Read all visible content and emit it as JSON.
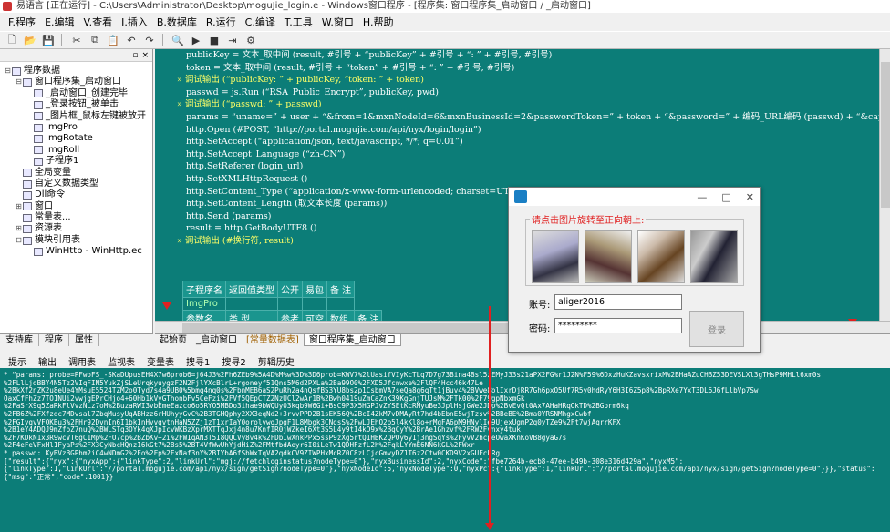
{
  "window": {
    "title": "易语言 [正在运行] - C:\\Users\\Administrator\\Desktop\\moguJie_login.e - Windows窗口程序 - [程序集: 窗口程序集_启动窗口 / _启动窗口]"
  },
  "menu": [
    "F.程序",
    "E.编辑",
    "V.查看",
    "I.插入",
    "B.数据库",
    "R.运行",
    "C.编译",
    "T.工具",
    "W.窗口",
    "H.帮助"
  ],
  "toolbar_icons": [
    "new-icon",
    "open-icon",
    "save-icon",
    "cut-icon",
    "copy-icon",
    "paste-icon",
    "undo-icon",
    "redo-icon",
    "find-icon",
    "run-icon",
    "stop-icon",
    "step-icon",
    "debug-icon"
  ],
  "tree": {
    "header_close": "×",
    "nodes": [
      {
        "label": "程序数据",
        "indent": 0,
        "toggle": "-"
      },
      {
        "label": "窗口程序集_启动窗口",
        "indent": 1,
        "toggle": "-"
      },
      {
        "label": "_启动窗口_创建完毕",
        "indent": 2,
        "toggle": ""
      },
      {
        "label": "_登录按钮_被单击",
        "indent": 2,
        "toggle": ""
      },
      {
        "label": "_图片框_鼠标左键被放开",
        "indent": 2,
        "toggle": ""
      },
      {
        "label": "ImgPro",
        "indent": 2,
        "toggle": ""
      },
      {
        "label": "ImgRotate",
        "indent": 2,
        "toggle": ""
      },
      {
        "label": "ImgRoll",
        "indent": 2,
        "toggle": ""
      },
      {
        "label": "子程序1",
        "indent": 2,
        "toggle": ""
      },
      {
        "label": "全局变量",
        "indent": 1,
        "toggle": ""
      },
      {
        "label": "自定义数据类型",
        "indent": 1,
        "toggle": ""
      },
      {
        "label": "Dll命令",
        "indent": 1,
        "toggle": ""
      },
      {
        "label": "窗口",
        "indent": 1,
        "toggle": "+"
      },
      {
        "label": "常量表...",
        "indent": 1,
        "toggle": ""
      },
      {
        "label": "资源表",
        "indent": 1,
        "toggle": "+"
      },
      {
        "label": "模块引用表",
        "indent": 1,
        "toggle": "-"
      },
      {
        "label": "WinHttp - WinHttp.ec",
        "indent": 2,
        "toggle": ""
      }
    ]
  },
  "left_tabs": [
    "支持库",
    "程序",
    "属性"
  ],
  "code_lines": [
    {
      "text": "publicKey = 文本_取中间 (result, #引号 + “publicKey” + #引号 + “: ” + #引号, #引号)",
      "bullet": false
    },
    {
      "text": "token = 文本_取中间 (result, #引号 + “token” + #引号 + “: ” + #引号, #引号)",
      "bullet": false
    },
    {
      "text": "调试输出 (“publicKey: ” + publicKey, “token: ” + token)",
      "bullet": true
    },
    {
      "text": "",
      "bullet": false
    },
    {
      "text": "passwd = js.Run (“RSA_Public_Encrypt”, publicKey, pwd)",
      "bullet": false
    },
    {
      "text": "调试输出 (“passwd: ” + passwd)",
      "bullet": true
    },
    {
      "text": "",
      "bullet": false
    },
    {
      "text": "params = “uname=” + user + “&from=1&mxnNodeId=6&mxnBusinessId=2&passwordToken=” + token + “&password=” + 编码_URL编码 (passwd) + “&captkey=” + capkey",
      "bullet": false
    },
    {
      "text": "http.Open (#POST, “http://portal.mogujie.com/api/nyx/login/login”)",
      "bullet": false
    },
    {
      "text": "http.SetAccept (“application/json, text/javascript, */*; q=0.01”)",
      "bullet": false
    },
    {
      "text": "http.SetAccept_Language (“zh-CN”)",
      "bullet": false
    },
    {
      "text": "http.SetReferer (login_url)",
      "bullet": false
    },
    {
      "text": "http.SetXMLHttpRequest ()",
      "bullet": false
    },
    {
      "text": "http.SetContent_Type (“application/x-www-form-urlencoded; charset=UTF-8”)",
      "bullet": false
    },
    {
      "text": "http.SetContent_Length (取文本长度 (params))",
      "bullet": false
    },
    {
      "text": "http.Send (params)",
      "bullet": false
    },
    {
      "text": "result = http.GetBodyUTF8 ()",
      "bullet": false
    },
    {
      "text": "调试输出 (#换行符, result)",
      "bullet": true
    }
  ],
  "sub_table": {
    "headers": [
      "子程序名",
      "返回值类型",
      "公开",
      "易包",
      "备 注"
    ],
    "row1": [
      "ImgPro",
      "",
      "",
      "",
      ""
    ],
    "headers2": [
      "参数名",
      "类 型",
      "参考",
      "可空",
      "数组",
      "备 注"
    ]
  },
  "editor_tabs": [
    "起始页",
    "_启动窗口",
    "[常量数据表]",
    "窗口程序集_启动窗口"
  ],
  "bottom_tabs": [
    "提示",
    "输出",
    "调用表",
    "监视表",
    "变量表",
    "搜寻1",
    "搜寻2",
    "剪辑历史"
  ],
  "output_lines": [
    "* “params: probe=PFwoFS_-SKaDUpusEH4X7w6prob6=j64J3%2Fh6ZEb9%5A4D%M%w%3D%3D6prob=KWV7%2lUasifVIyKcTLq7D7g73Bina4Bsl5zEMyJ33s21aPX2FG%r1J2N%F59%6DxzHuKZavsxrixM%2BHaAZuCHBZ53DEVSLXl3gTHsP9MHLl6xm0s",
    "%2FLlLjdBBY4N5Tz2VIqFIN5YukZjSLeUrqkyuygzF2N2FjlYXcBlrL+rgoneyf51Qns5M6d2PXLa%2Ba99O0%2FXD5Jfcnwxe%2FlQF4Hcc46k47Le",
    "%2BkXf2nZK2u8eUe4YMsuE5524TZM2o0Tyd7s4a9UB0%5bmq4nq0s%2FbnMEB6aS2PuRh2a4nQsfBS3YU8bs2p1CsbmVA7seQa8g6qTt1jBuv4%2BVwe8olIxrDjRR7Gh6pxO5Uf7R5y0hdRyY6H3I6Z5p8%2BpRXe7YxT3DL6J6fLlbVp7Sw",
    "OaxCfFhZz7TO1NUi2vwjgEPrCHjo4+60Hb1kVyGThonbFv5CeFzi%2FVf5QEpCTZ2NzUCl2wAr1B%2Bwh0419uZmCaZnK39KgGnjTUJsM%2FTk00%2F79gpNbxmGk",
    "%2FaSrX9q5ZaRkFlVvzNLz7oM%2BuzaRWI3vbEmeEazco6o5RYO5MBDo3ihae9bWQUy03kqb9W6Gi+BsC9P3X5HGPJvZYSEtKcRMyuBe3JplHsjGWe2JDp%2BvEvQt0Ax7AHaHRqOkTD%2BGbrm6kq",
    "%2FB6Z%2FXfzdc7MDvsal7ZbqMusyUqABHzz6rHUhyyGvC%2B3TGHQphy2XX3eqNd2+3rvvPPD2B1sEK56Q%2BcI4ZkM7vDMAyRt7hd4bEbnE5wjTzsv%2BBeBE%2Bma0YRSNMhgxCwbf",
    "%2FGIyqvVFOKBu3%2FHr92DvnIn6I1bkInHvvqvtnHaN5ZZj1zT1xrIaY0orolvwqJpgF1L8Mbgk3CNqsS%2FwLJEhQ2p5l4kKl8o+rMqFA6pM9HNylIe9UjexUgmP2q0yTZe9%2Ft7wjAqrrKFX",
    "%2B1eY4ADQJ9mZfoZ7nuQ%2BWLSTq3OYk4qXJpIcvWKBzXprMXTTqJxj4n8u7KnfIR0jWZkeI6Xt3S5L4y9tI4kO9x%2BqCyY%2BrAe1Ghzvf%2FRW2Fvnxy4tuk",
    "%2F7KDkN1x3R9wcVT6gC1Mp%2FO7cp%2BZbKv+2i%2FWIqAN3T5I8QQCVy8v4k%2FDbIwXnkPPx5ssP9zXg5rtQ1HBK2QPOy6y1j3ngSqYs%2FyvV2hcpeOwaXKnKoVB8gyaG7s",
    "%2F4eFeVFxHl1FyaPs%2FX3CyNbcHQnz16kGt7%2Bs5%2BT4VfWwUhYjdHiZ%2FMtfbdAeyr6I0iLeTw1QDHFzfL2h%2FqkLYYmE6NN6kGL%2FWxr",
    "* passwd: KyBVzBGPhm2iC4wNDmG2%2Fo%2Fp%2FxNaf3nY%2BIYbA6fSbWxTqVA2qdkCV9ZIWPHxMcRZ0C8zLCjcGmvyDZ1T6z2Ctw0CKD9V2xGUFcLRg",
    "[\"result\":{\"nyx\":{\"nyxApp\":{\"linkType\":2,\"linkUrl\":\"mgj://fetchloginstatus?nodeType=0\"},\"nyxBusinessId\":2,\"nyxCode\":\"fbe7264b-ecb8-47ee-b49b-308e316d429a\",\"nyxM5\":",
    "{\"linkType\":1,\"linkUrl\":\"//portal.mogujie.com/api/nyx/sign/getSign?nodeType=0\"},\"nyxNodeId\":5,\"nyxNodeType\":0,\"nyxPc\":{\"linkType\":1,\"linkUrl\":\"//portal.mogujie.com/api/nyx/sign/getSign?nodeType=0\"}}},\"status\":",
    "{\"msg\":\"正常\",\"code\":1001}}"
  ],
  "dialog": {
    "group_label": "请点击图片旋转至正向朝上:",
    "account_label": "账号:",
    "account_value": "aliger2016",
    "password_label": "密码:",
    "password_value": "*********",
    "login_button": "登录",
    "min": "—",
    "max": "□",
    "close": "✕"
  },
  "colors": {
    "editor_bg": "#0c7d78",
    "accent_red": "#e02020",
    "keyword_yellow": "#ffff66"
  }
}
